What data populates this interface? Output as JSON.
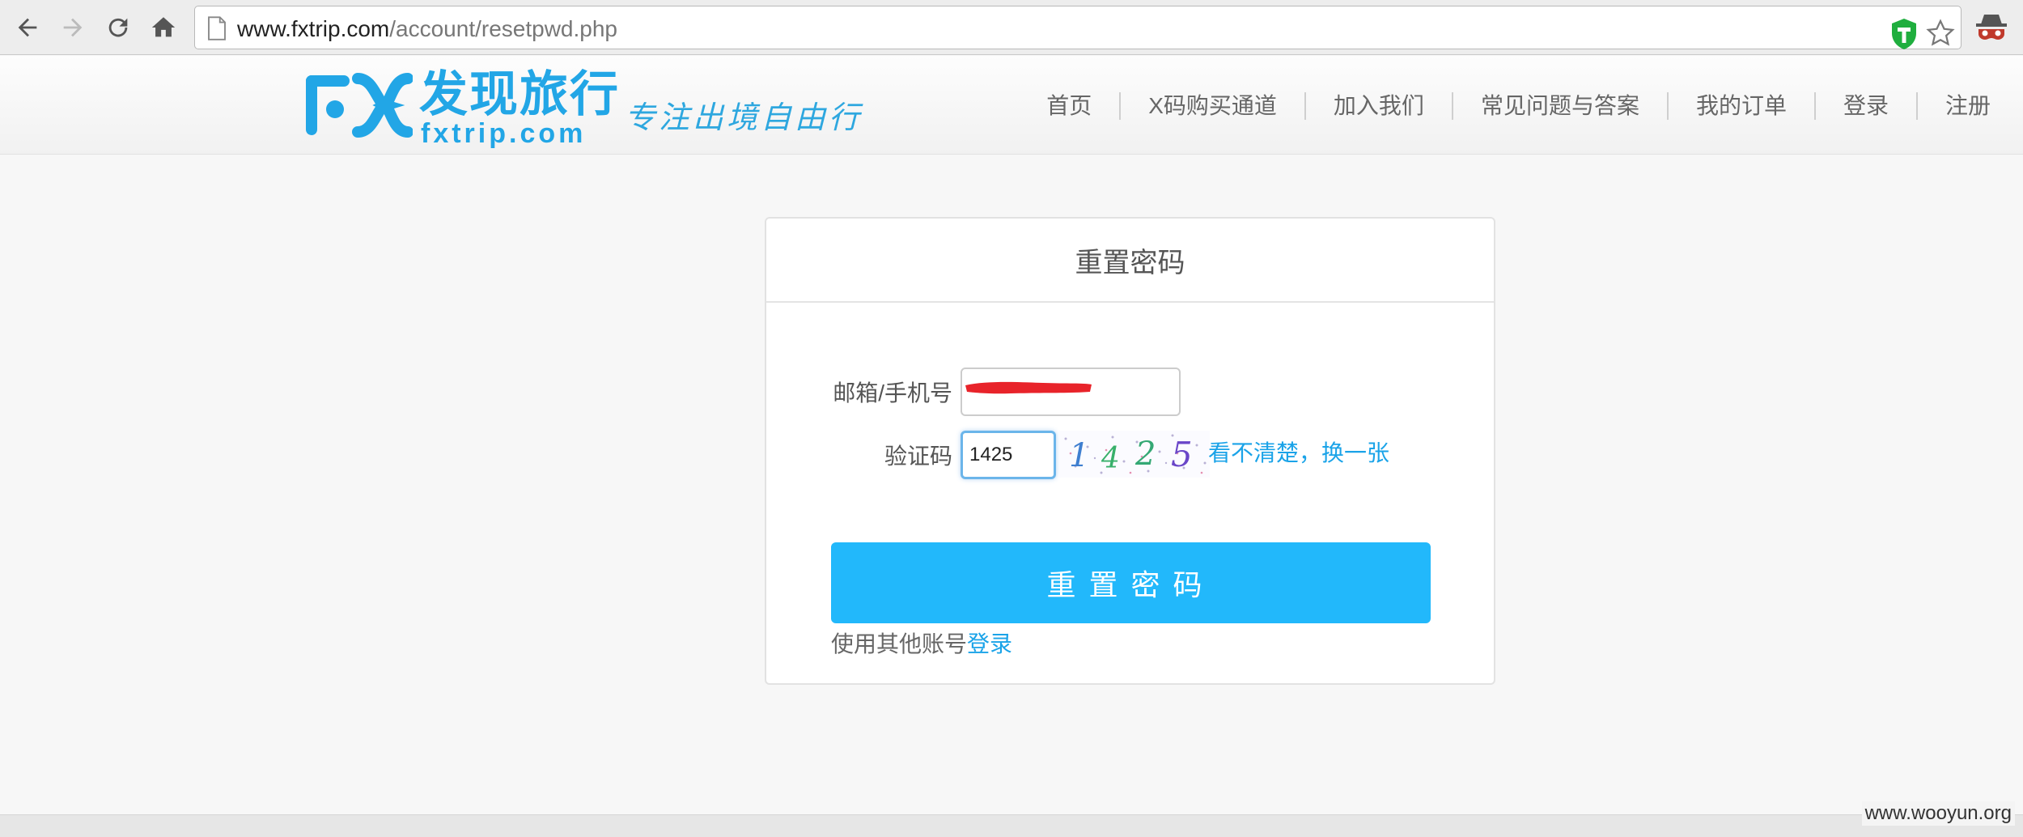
{
  "browser": {
    "url_domain": "www.fxtrip.com",
    "url_path": "/account/resetpwd.php",
    "icons": [
      "back-arrow-icon",
      "forward-arrow-icon",
      "reload-icon",
      "home-icon",
      "page-icon",
      "tampermonkey-icon",
      "bookmark-star-icon",
      "incognito-mask-icon"
    ]
  },
  "header": {
    "logo_cn": "发现旅行",
    "logo_en": "fxtrip.com",
    "slogan": "专注出境自由行",
    "nav": [
      "首页",
      "X码购买通道",
      "加入我们",
      "常见问题与答案",
      "我的订单",
      "登录",
      "注册"
    ]
  },
  "form": {
    "title": "重置密码",
    "email_label": "邮箱/手机号",
    "code_label": "验证码",
    "code_value": "1425",
    "captcha_digits": [
      "1",
      "4",
      "2",
      "5"
    ],
    "refresh_link": "看不清楚，换一张",
    "submit_label": "重置密码",
    "other_prefix": "使用其他账号",
    "other_link": "登录"
  },
  "colors": {
    "brand": "#22a6e6",
    "button": "#22b8fb",
    "link": "#1aa3e8"
  },
  "watermark": "www.wooyun.org"
}
